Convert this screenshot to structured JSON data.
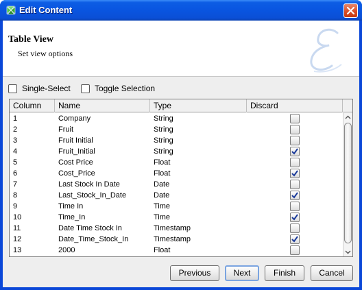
{
  "window": {
    "title": "Edit Content",
    "close_icon": "close-icon",
    "app_icon": "app-icon"
  },
  "banner": {
    "title": "Table View",
    "subtitle": "Set view options",
    "watermark_icon": "script-e-watermark-icon"
  },
  "options": {
    "single_select": "Single-Select",
    "toggle_selection": "Toggle Selection",
    "single_select_checked": false,
    "toggle_selection_checked": false
  },
  "table": {
    "columns": [
      "Column",
      "Name",
      "Type",
      "Discard"
    ],
    "rows": [
      {
        "column": "1",
        "name": "Company",
        "type": "String",
        "discard": false
      },
      {
        "column": "2",
        "name": "Fruit",
        "type": "String",
        "discard": false
      },
      {
        "column": "3",
        "name": "Fruit Initial",
        "type": "String",
        "discard": false
      },
      {
        "column": "4",
        "name": "Fruit_Initial",
        "type": "String",
        "discard": true
      },
      {
        "column": "5",
        "name": "Cost Price",
        "type": "Float",
        "discard": false
      },
      {
        "column": "6",
        "name": "Cost_Price",
        "type": "Float",
        "discard": true
      },
      {
        "column": "7",
        "name": "Last Stock In Date",
        "type": "Date",
        "discard": false
      },
      {
        "column": "8",
        "name": "Last_Stock_In_Date",
        "type": "Date",
        "discard": true
      },
      {
        "column": "9",
        "name": "Time In",
        "type": "Time",
        "discard": false
      },
      {
        "column": "10",
        "name": "Time_In",
        "type": "Time",
        "discard": true
      },
      {
        "column": "11",
        "name": "Date Time Stock In",
        "type": "Timestamp",
        "discard": false
      },
      {
        "column": "12",
        "name": "Date_Time_Stock_In",
        "type": "Timestamp",
        "discard": true
      },
      {
        "column": "13",
        "name": "2000",
        "type": "Float",
        "discard": false
      }
    ]
  },
  "buttons": {
    "previous": "Previous",
    "next": "Next",
    "finish": "Finish",
    "cancel": "Cancel"
  },
  "colors": {
    "titlebar": "#0a4fd6",
    "client_bg": "#eeeeee",
    "check": "#1a3a9a"
  }
}
